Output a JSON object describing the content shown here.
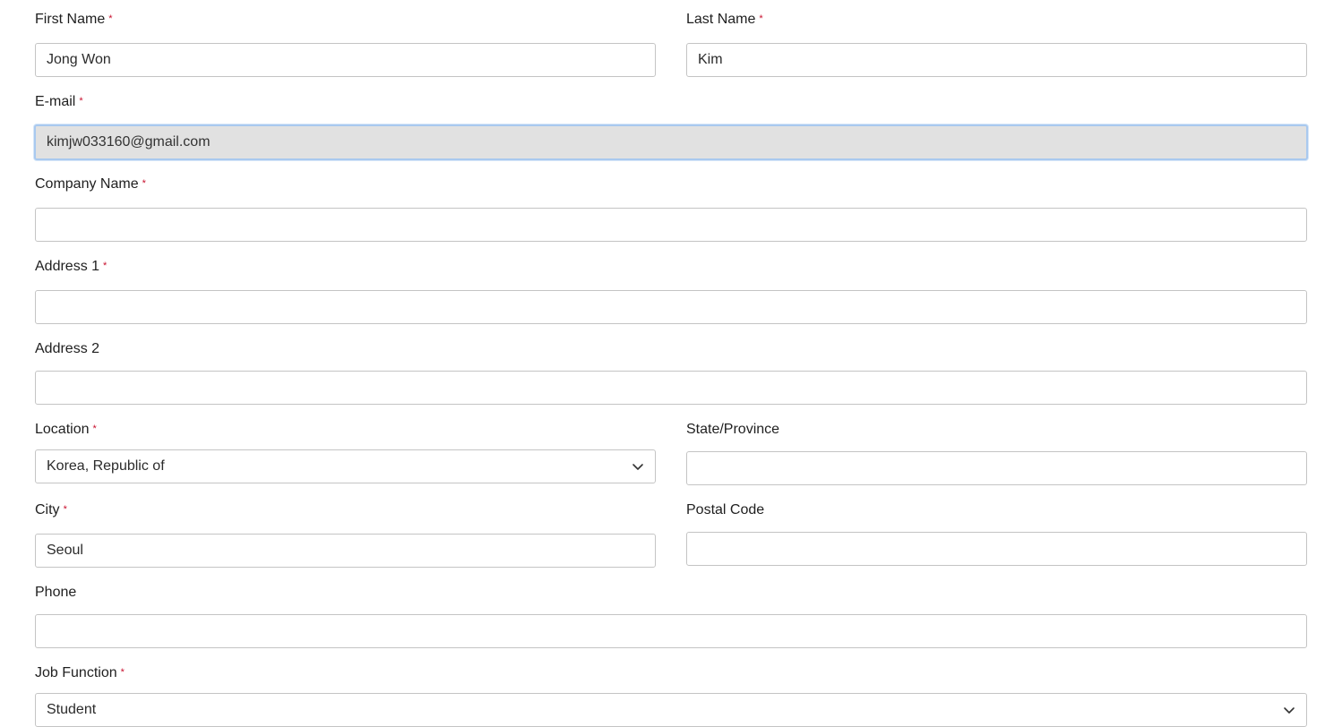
{
  "form": {
    "first_name": {
      "label": "First Name",
      "value": "Jong Won"
    },
    "last_name": {
      "label": "Last Name",
      "value": "Kim"
    },
    "email": {
      "label": "E-mail",
      "value": "kimjw033160@gmail.com"
    },
    "company_name": {
      "label": "Company Name",
      "value": ""
    },
    "address1": {
      "label": "Address 1",
      "value": ""
    },
    "address2": {
      "label": "Address 2",
      "value": ""
    },
    "location": {
      "label": "Location",
      "value": "Korea, Republic of"
    },
    "state": {
      "label": "State/Province",
      "value": ""
    },
    "city": {
      "label": "City",
      "value": "Seoul"
    },
    "postal_code": {
      "label": "Postal Code",
      "value": ""
    },
    "phone": {
      "label": "Phone",
      "value": ""
    },
    "job_function": {
      "label": "Job Function",
      "value": "Student"
    },
    "required_marker": "*"
  },
  "colors": {
    "required": "#c8102e",
    "border": "#c4c4c4",
    "disabled_bg": "#e1e1e1",
    "focus_border": "#a9c9ef"
  },
  "icons": {
    "select_arrow": "chevron-down-icon"
  }
}
